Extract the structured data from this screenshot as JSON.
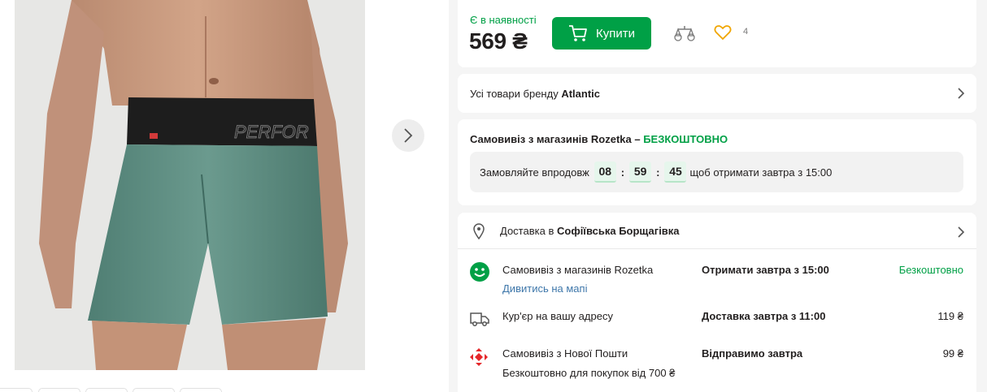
{
  "gallery": {
    "photo_text": "PERFOR",
    "thumb_count": 5
  },
  "buy": {
    "stock": "Є в наявності",
    "price": "569 ₴",
    "buy_label": "Купити",
    "fav_count": "4"
  },
  "brand": {
    "prefix": "Усі товари бренду",
    "name": "Atlantic"
  },
  "pickup": {
    "title": "Самовивіз з магазинів Rozetka – ",
    "free": "БЕЗКОШТОВНО",
    "order_within": "Замовляйте впродовж",
    "hours": "08",
    "minutes": "59",
    "seconds": "45",
    "get_by": "щоб отримати завтра з 15:00"
  },
  "delivery": {
    "to_label": "Доставка в",
    "city": "Софіївська Борщагівка",
    "options": [
      {
        "name": "Самовивіз з магазинів Rozetka",
        "link": "Дивитись на мапі",
        "when": "Отримати завтра з 15:00",
        "cost": "Безкоштовно"
      },
      {
        "name": "Кур'єр на вашу адресу",
        "when": "Доставка завтра з 11:00",
        "cost": "119 ₴"
      },
      {
        "name": "Самовивіз з Нової Пошти",
        "sub": "Безкоштовно для покупок від 700 ₴",
        "when": "Відправимо завтра",
        "cost": "99 ₴"
      }
    ]
  },
  "colors": {
    "accent_green": "#00a046",
    "link_blue": "#3e77aa"
  }
}
